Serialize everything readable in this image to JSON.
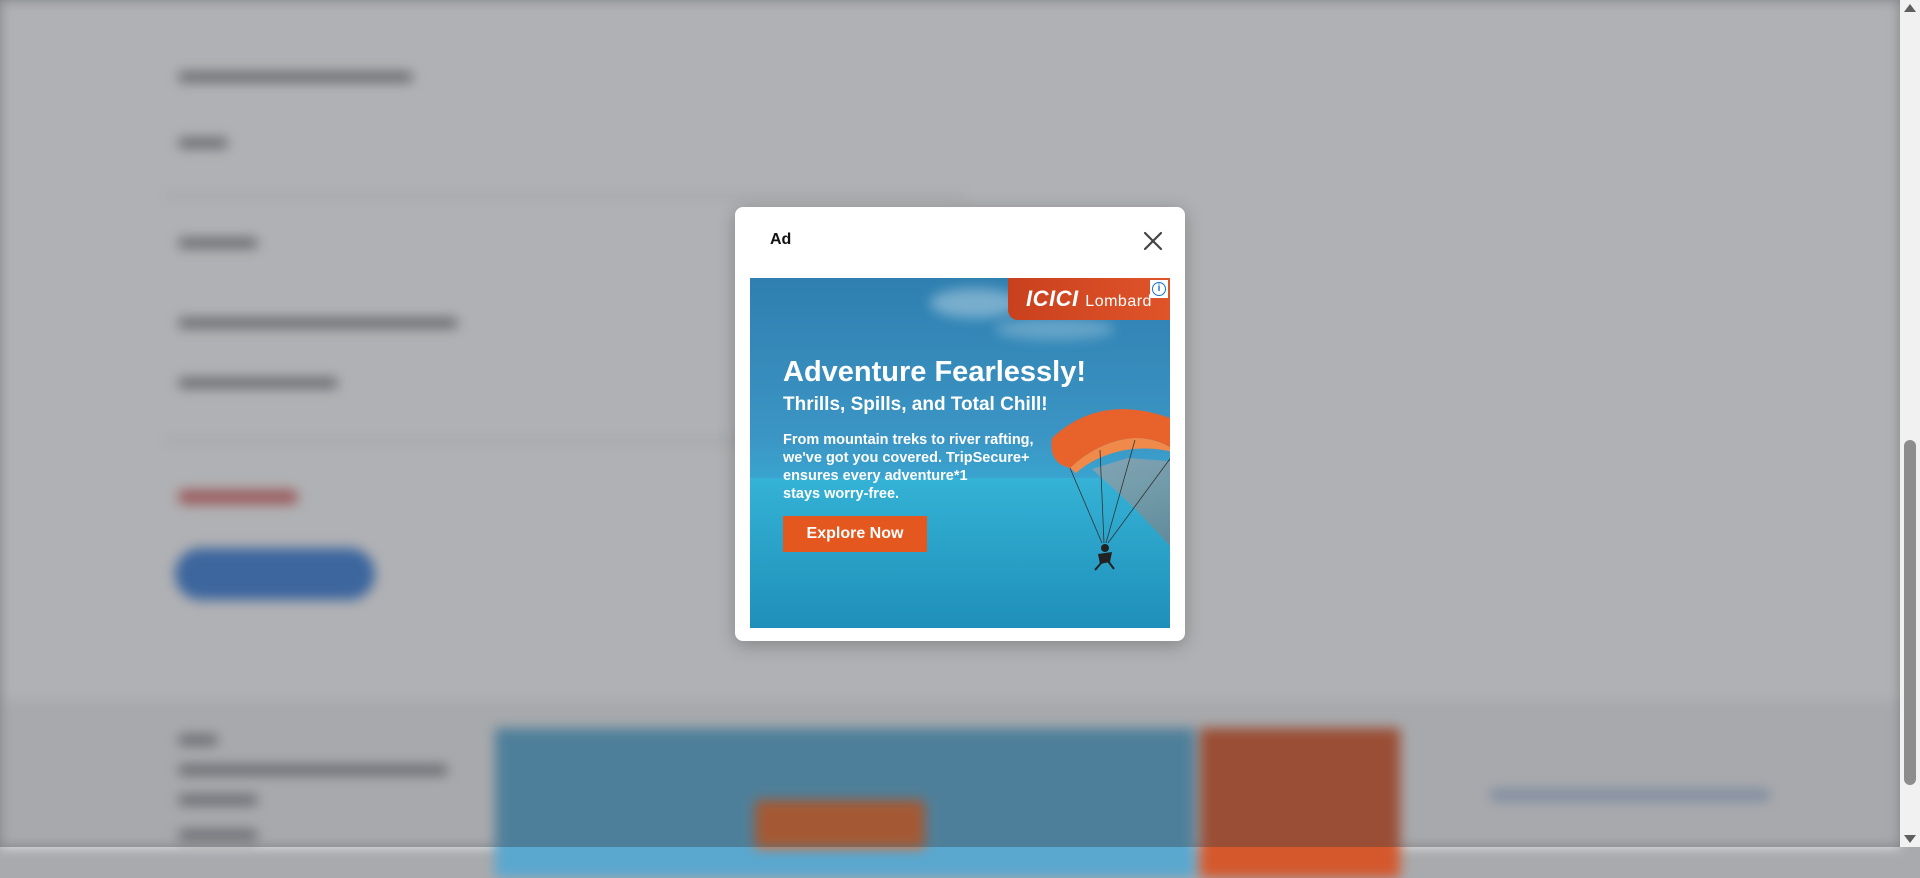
{
  "modal": {
    "title": "Ad",
    "close_icon": "close-icon"
  },
  "ad": {
    "brand": "ICICI",
    "brand_suffix": "Lombard",
    "adchoices_icon": "info-icon",
    "headline": "Adventure Fearlessly!",
    "subheadline": "Thrills, Spills, and Total Chill!",
    "body_lines": [
      "From mountain treks to river rafting,",
      "we've got you covered. TripSecure+",
      "ensures every adventure*1",
      "stays worry-free."
    ],
    "cta": "Explore Now"
  },
  "colors": {
    "overlay": "#a9aaad",
    "modal_bg": "#ffffff",
    "cta_bg": "#e4571f",
    "brand_bg": "#d84a24",
    "sky": "#3b95c4"
  }
}
